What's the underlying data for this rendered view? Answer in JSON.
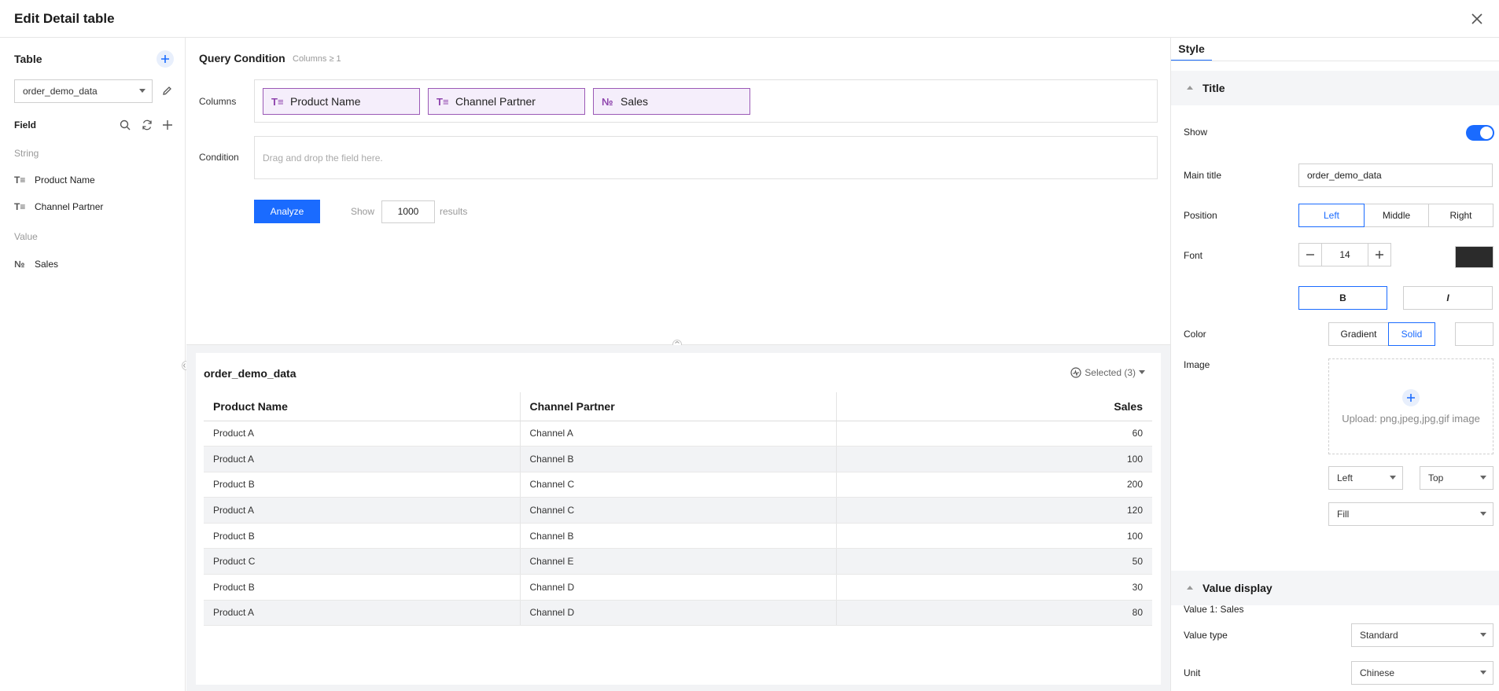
{
  "header": {
    "title": "Edit Detail table"
  },
  "left": {
    "table_title": "Table",
    "table_selected": "order_demo_data",
    "field_title": "Field",
    "groups": [
      {
        "label": "String",
        "items": [
          {
            "icon": "T≡",
            "label": "Product Name"
          },
          {
            "icon": "T≡",
            "label": "Channel Partner"
          }
        ]
      },
      {
        "label": "Value",
        "items": [
          {
            "icon": "№",
            "label": "Sales"
          }
        ]
      }
    ]
  },
  "query": {
    "title": "Query Condition",
    "subtitle": "Columns ≥ 1",
    "columns_label": "Columns",
    "columns": [
      {
        "icon": "T≡",
        "label": "Product Name"
      },
      {
        "icon": "T≡",
        "label": "Channel Partner"
      },
      {
        "icon": "№",
        "label": "Sales"
      }
    ],
    "condition_label": "Condition",
    "condition_placeholder": "Drag and drop the field here.",
    "analyze_label": "Analyze",
    "show_label": "Show",
    "show_value": "1000",
    "results_label": "results"
  },
  "preview": {
    "title": "order_demo_data",
    "selected_label": "Selected (3)",
    "headers": [
      "Product Name",
      "Channel Partner",
      "Sales"
    ],
    "rows": [
      [
        "Product A",
        "Channel A",
        "60"
      ],
      [
        "Product A",
        "Channel B",
        "100"
      ],
      [
        "Product B",
        "Channel C",
        "200"
      ],
      [
        "Product A",
        "Channel C",
        "120"
      ],
      [
        "Product B",
        "Channel B",
        "100"
      ],
      [
        "Product C",
        "Channel E",
        "50"
      ],
      [
        "Product B",
        "Channel D",
        "30"
      ],
      [
        "Product A",
        "Channel D",
        "80"
      ]
    ]
  },
  "style": {
    "tab": "Style",
    "title_section": "Title",
    "show_label": "Show",
    "main_title_label": "Main title",
    "main_title_value": "order_demo_data",
    "position_label": "Position",
    "position_options": [
      "Left",
      "Middle",
      "Right"
    ],
    "font_label": "Font",
    "font_size": "14",
    "bold_label": "B",
    "italic_label": "I",
    "color_label": "Color",
    "color_options": [
      "Gradient",
      "Solid"
    ],
    "image_label": "Image",
    "upload_text": "Upload: png,jpeg,jpg,gif image",
    "align_h": "Left",
    "align_v": "Top",
    "fit": "Fill",
    "value_section": "Value display",
    "value_1_label": "Value 1: Sales",
    "value_type_label": "Value type",
    "value_type": "Standard",
    "unit_label": "Unit",
    "unit": "Chinese",
    "accent_color": "#1a6bff",
    "font_color": "#2b2b2b"
  }
}
